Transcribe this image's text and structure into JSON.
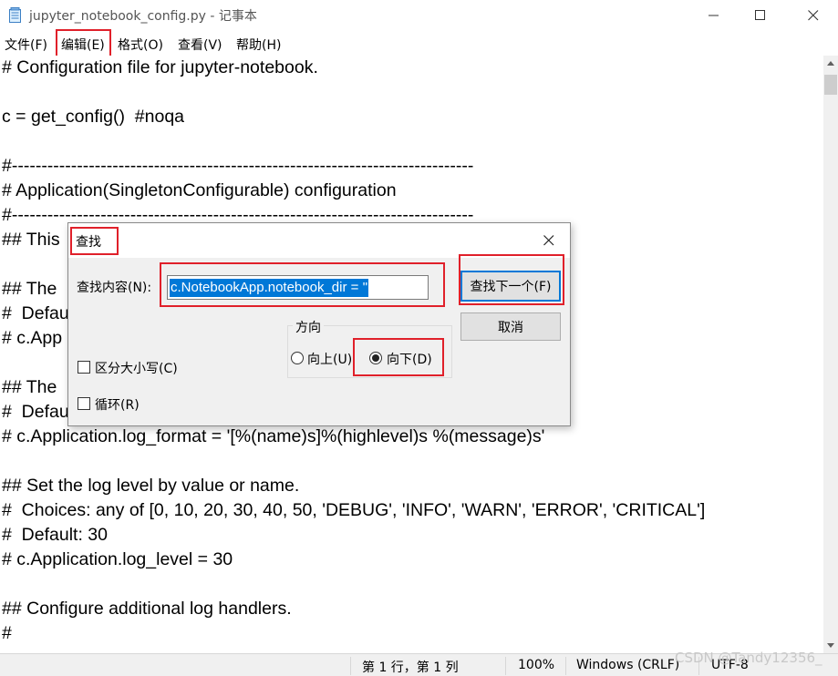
{
  "window": {
    "title": "jupyter_notebook_config.py - 记事本"
  },
  "menu": [
    "文件(F)",
    "编辑(E)",
    "格式(O)",
    "查看(V)",
    "帮助(H)"
  ],
  "editor_lines": [
    "# Configuration file for jupyter-notebook.",
    "",
    "c = get_config()  #noqa",
    "",
    "#------------------------------------------------------------------------------",
    "# Application(SingletonConfigurable) configuration",
    "#------------------------------------------------------------------------------",
    "## This",
    "",
    "## The",
    "#  Defau",
    "# c.App",
    "",
    "## The",
    "#  Defau",
    "# c.Application.log_format = '[%(name)s]%(highlevel)s %(message)s'",
    "",
    "## Set the log level by value or name.",
    "#  Choices: any of [0, 10, 20, 30, 40, 50, 'DEBUG', 'INFO', 'WARN', 'ERROR', 'CRITICAL']",
    "#  Default: 30",
    "# c.Application.log_level = 30",
    "",
    "## Configure additional log handlers.",
    "#"
  ],
  "status": {
    "position": "第 1 行，第 1 列",
    "zoom": "100%",
    "line_ending": "Windows (CRLF)",
    "encoding": "UTF-8"
  },
  "watermark": "CSDN @Tandy12356_",
  "find_dialog": {
    "title": "查找",
    "find_label": "查找内容(N):",
    "find_value": "c.NotebookApp.notebook_dir = ''",
    "find_next": "查找下一个(F)",
    "cancel": "取消",
    "direction_label": "方向",
    "up": "向上(U)",
    "down": "向下(D)",
    "direction_selected": "down",
    "match_case": "区分大小写(C)",
    "match_case_checked": false,
    "wrap": "循环(R)",
    "wrap_checked": false
  },
  "colors": {
    "selection": "#0078d7",
    "annotation_red": "#e0202a"
  }
}
